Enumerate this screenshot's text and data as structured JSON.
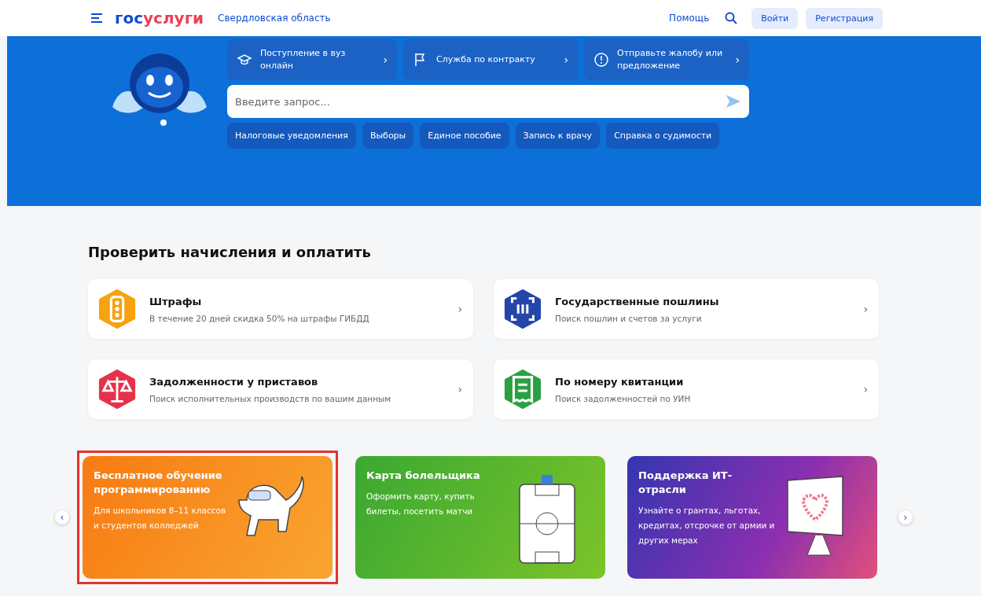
{
  "header": {
    "logo_part1": "гос",
    "logo_part2": "услуги",
    "region": "Свердловская область",
    "help": "Помощь",
    "login": "Войти",
    "register": "Регистрация"
  },
  "hero": {
    "quick_links": [
      {
        "kind": "graduation",
        "label": "Поступление в вуз онлайн",
        "arrow": "›"
      },
      {
        "kind": "flag",
        "label": "Служба по контракту",
        "arrow": "›"
      },
      {
        "kind": "info",
        "label": "Отправьте жалобу или предложение",
        "arrow": "›"
      }
    ],
    "search": {
      "placeholder": "Введите запрос..."
    },
    "chips": [
      "Налоговые уведомления",
      "Выборы",
      "Единое пособие",
      "Запись к врачу",
      "Справка о судимости"
    ]
  },
  "payments": {
    "title": "Проверить начисления и оплатить",
    "items": [
      {
        "kind": "traffic-light",
        "color": "#f7a20f",
        "title": "Штрафы",
        "subtitle": "В течение 20 дней скидка 50% на штрафы ГИБДД",
        "arrow": "›"
      },
      {
        "kind": "qr",
        "color": "#2446a8",
        "title": "Государственные пошлины",
        "subtitle": "Поиск пошлин и счетов за услуги",
        "arrow": "›"
      },
      {
        "kind": "scales",
        "color": "#e5324a",
        "title": "Задолженности у приставов",
        "subtitle": "Поиск исполнительных производств по вашим данным",
        "arrow": "›"
      },
      {
        "kind": "receipt",
        "color": "#2aa043",
        "title": "По номеру квитанции",
        "subtitle": "Поиск задолженностей по УИН",
        "arrow": "›"
      }
    ]
  },
  "promos": {
    "prev": "‹",
    "next": "›",
    "items": [
      {
        "kind": "dog",
        "highlighted": true,
        "title": "Бесплатное обучение программированию",
        "text": "Для школьников 8–11 классов и студентов колледжей"
      },
      {
        "kind": "stadium",
        "highlighted": false,
        "title": "Карта болельщика",
        "text": "Оформить карту, купить билеты, посетить матчи"
      },
      {
        "kind": "monitor",
        "highlighted": false,
        "title": "Поддержка ИТ-отрасли",
        "text": "Узнайте о грантах, льготах, кредитах, отсрочке от армии и других мерах"
      }
    ]
  }
}
